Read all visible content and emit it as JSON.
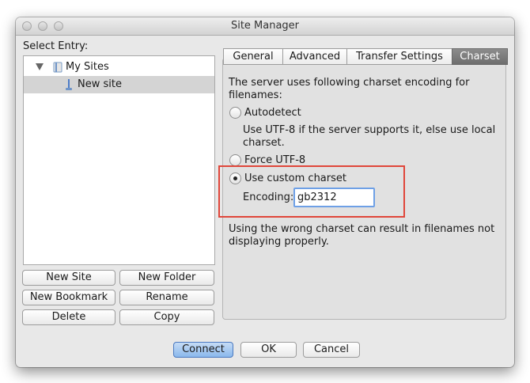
{
  "window": {
    "title": "Site Manager"
  },
  "left": {
    "select_entry_label": "Select Entry:",
    "tree": {
      "root": {
        "label": "My Sites",
        "expanded": true
      },
      "children": [
        {
          "label": "New site",
          "selected": true
        }
      ]
    },
    "buttons": {
      "new_site": "New Site",
      "new_folder": "New Folder",
      "new_bookmark": "New Bookmark",
      "rename": "Rename",
      "delete": "Delete",
      "copy": "Copy"
    }
  },
  "tabs": [
    {
      "label": "General",
      "active": false
    },
    {
      "label": "Advanced",
      "active": false
    },
    {
      "label": "Transfer Settings",
      "active": false
    },
    {
      "label": "Charset",
      "active": true
    }
  ],
  "charset": {
    "intro": "The server uses following charset encoding for filenames:",
    "options": {
      "autodetect": {
        "label": "Autodetect",
        "checked": false,
        "description": "Use UTF-8 if the server supports it, else use local charset."
      },
      "force_utf8": {
        "label": "Force UTF-8",
        "checked": false
      },
      "custom": {
        "label": "Use custom charset",
        "checked": true
      }
    },
    "encoding_label": "Encoding:",
    "encoding_value": "gb2312",
    "warning": "Using the wrong charset can result in filenames not displaying properly."
  },
  "footer": {
    "connect": "Connect",
    "ok": "OK",
    "cancel": "Cancel"
  },
  "colors": {
    "highlight_border": "#e0463a",
    "default_button": "#8ab8ec",
    "active_tab": "#7d7d7d"
  }
}
